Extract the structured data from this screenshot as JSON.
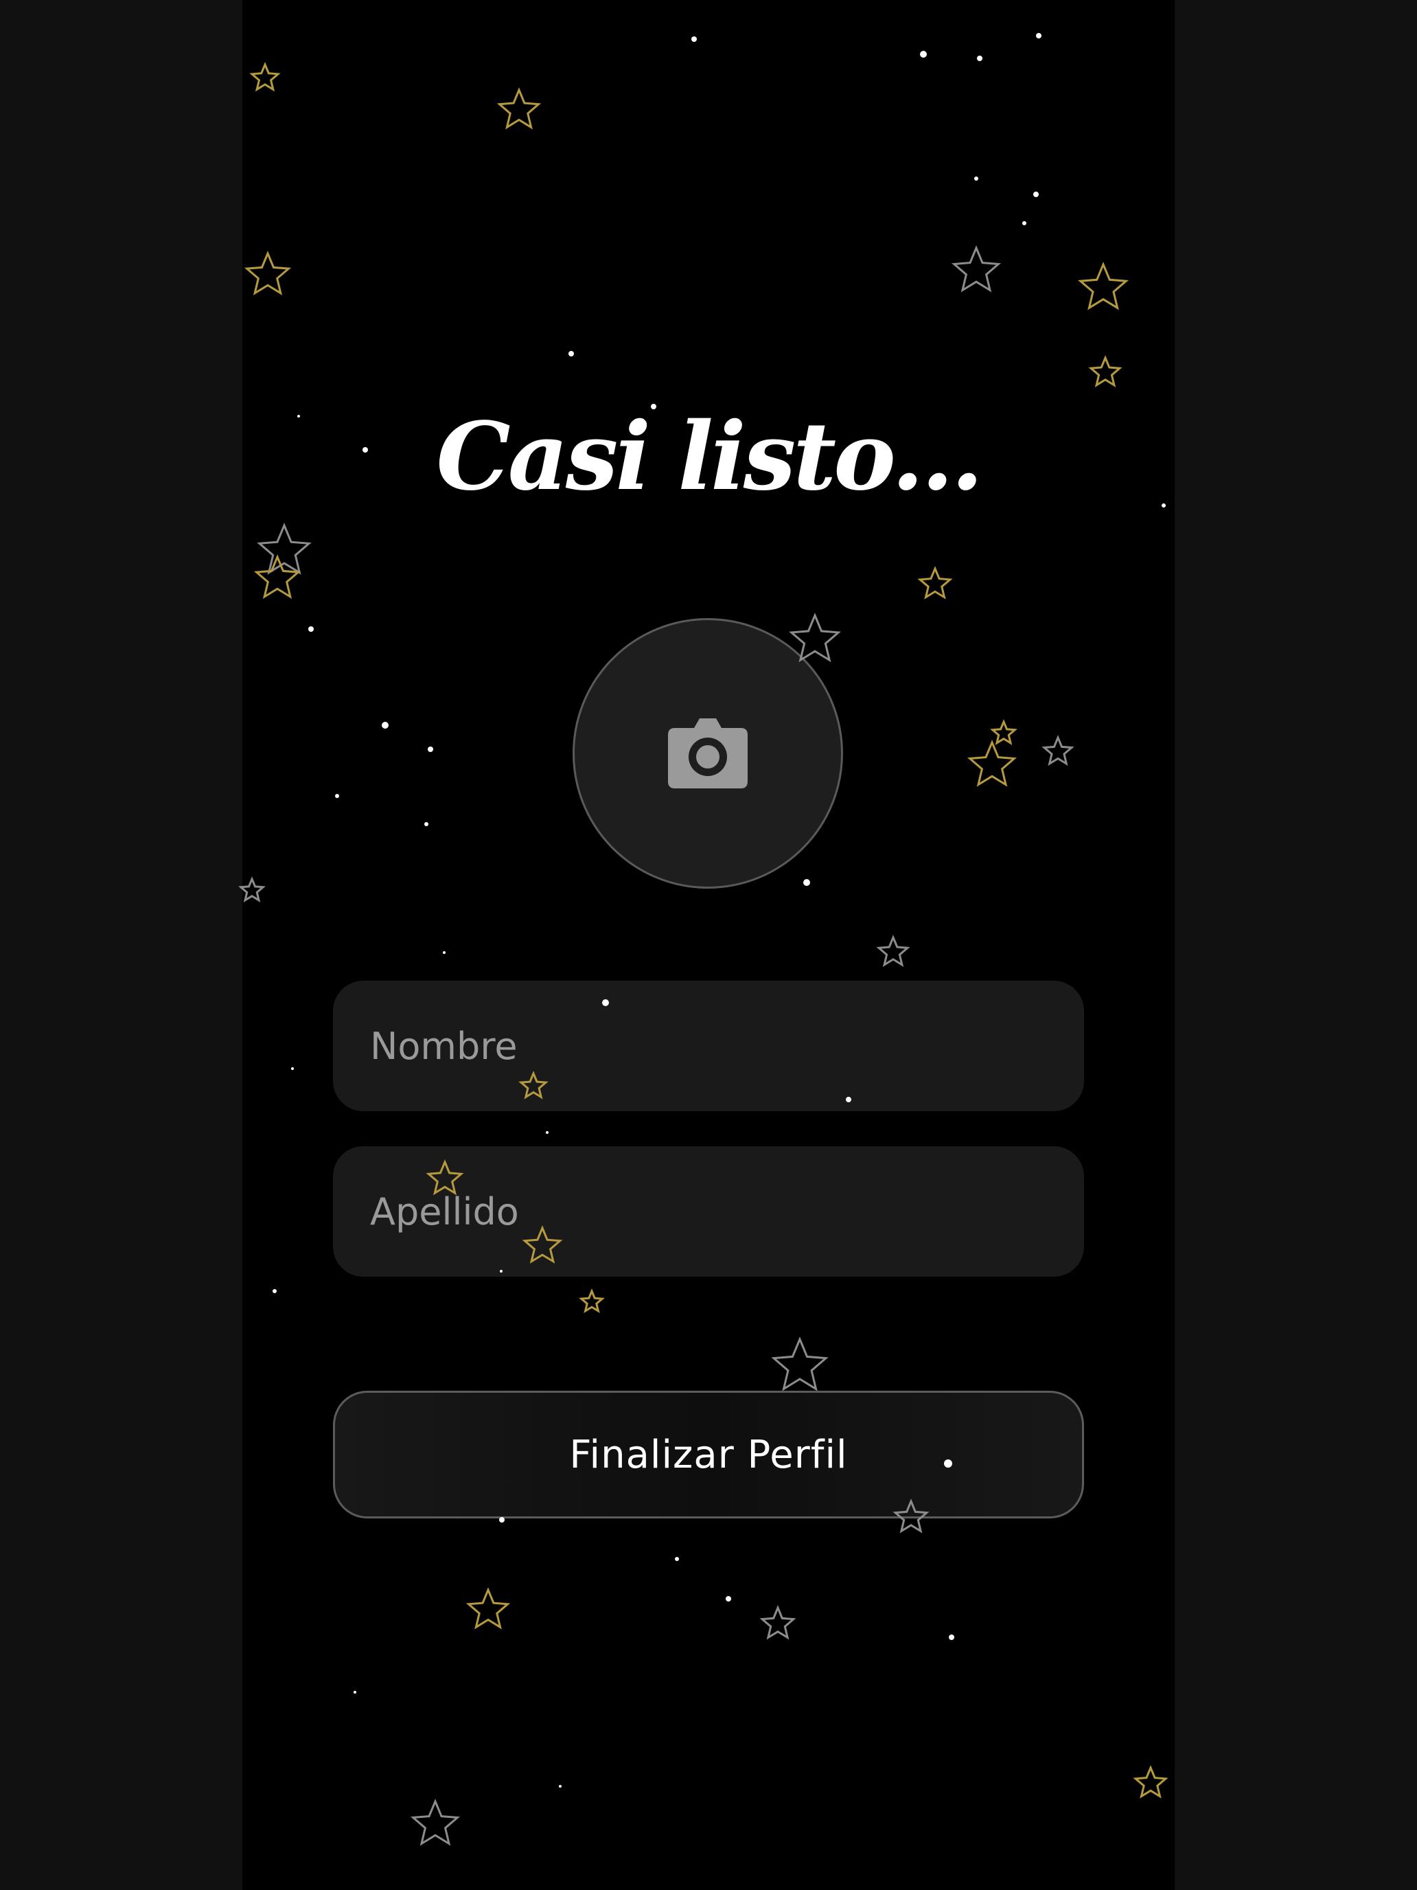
{
  "app": {
    "title": "Casi listo..."
  },
  "avatar_picker": {
    "icon": "camera-icon"
  },
  "form": {
    "first_name_placeholder": "Nombre",
    "first_name_value": "",
    "last_name_placeholder": "Apellido",
    "last_name_value": ""
  },
  "actions": {
    "finish_label": "Finalizar Perfil"
  },
  "colors": {
    "background": "#000000",
    "gold_star": "#b59a3e",
    "silver_star": "#8c8c8c",
    "field_background": "#1a1a1a",
    "placeholder_text": "#9a9a9a"
  }
}
